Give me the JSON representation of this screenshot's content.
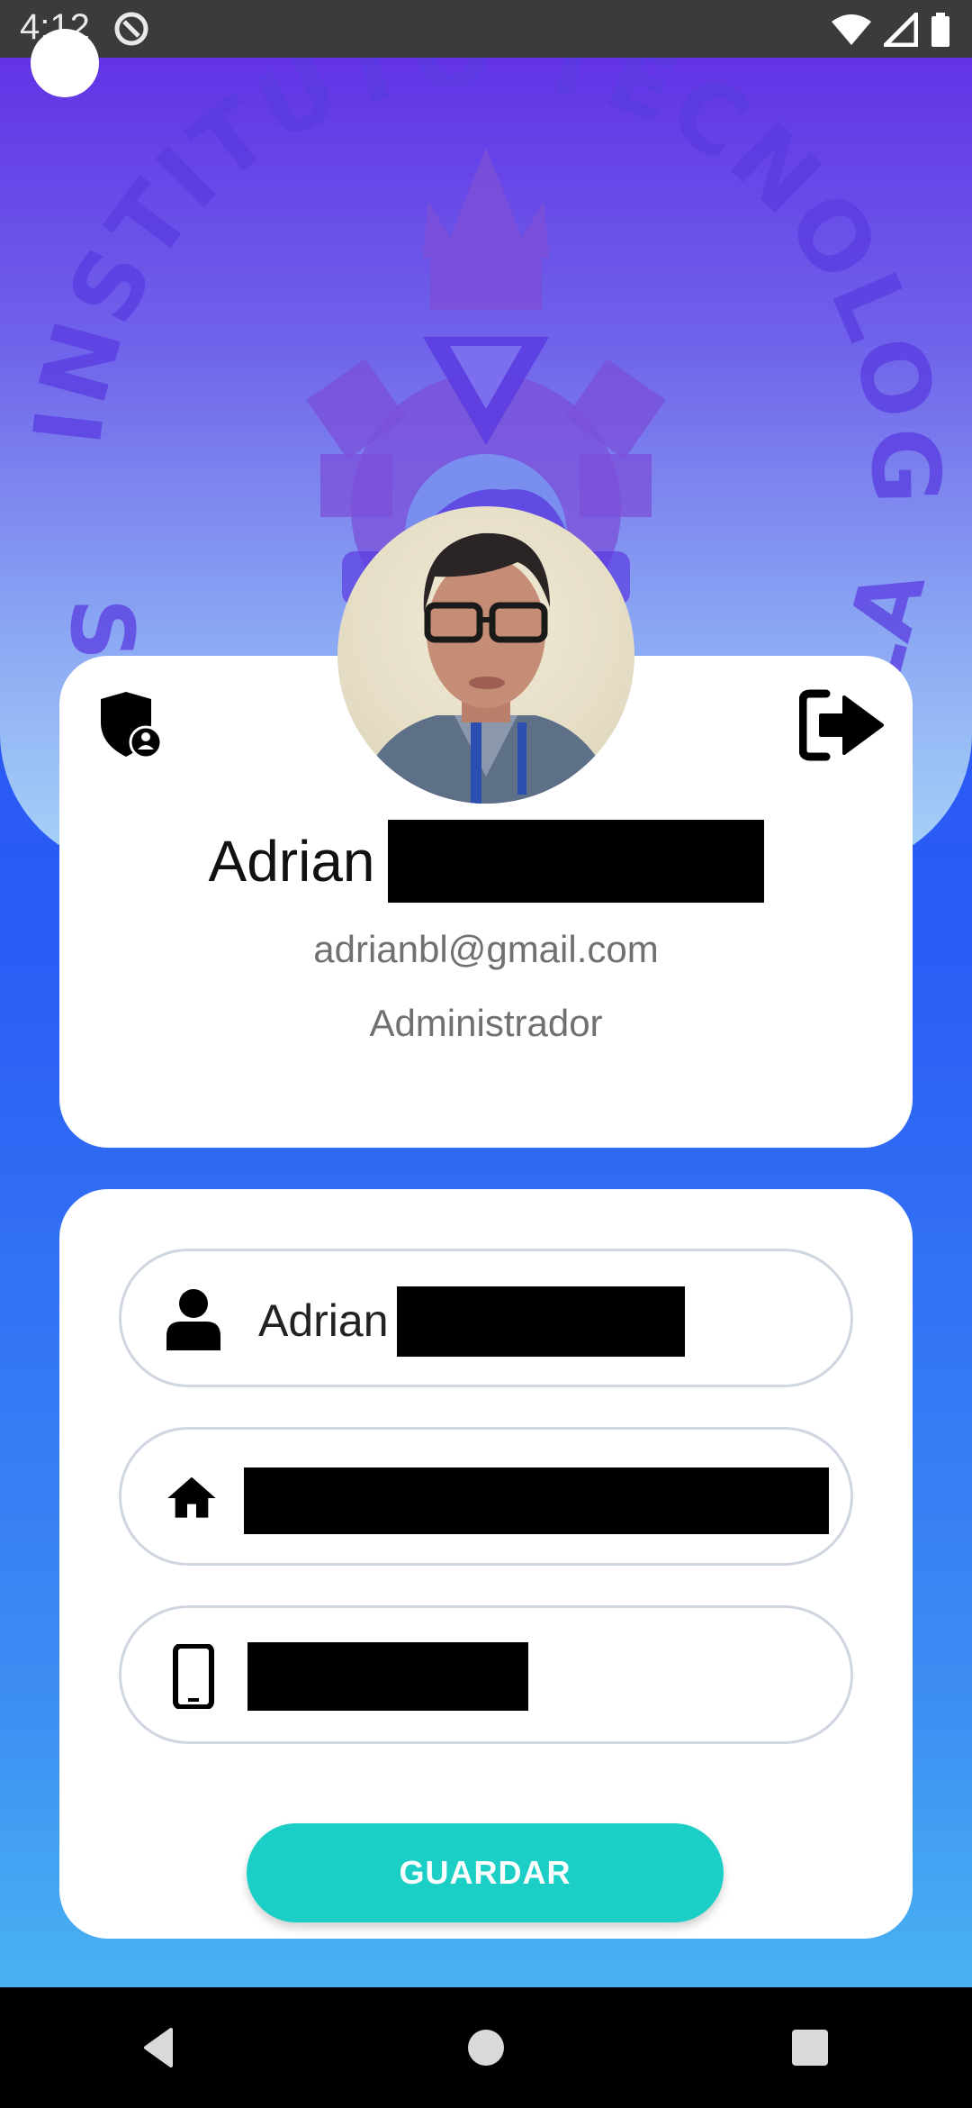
{
  "status_bar": {
    "time": "4:12"
  },
  "emblem": {
    "top_arc_text": "INSTITUTO TECNOLOGICO",
    "left_fragment": "SU",
    "right_fragment": "LA"
  },
  "profile": {
    "first_name": "Adrian",
    "email": "adrianbl@gmail.com",
    "role": "Administrador"
  },
  "form": {
    "name_value": "Adrian",
    "save_label": "GUARDAR"
  },
  "icons": {
    "shield": "admin-shield-icon",
    "logout": "logout-icon",
    "person": "person-icon",
    "home": "home-icon",
    "phone": "phone-icon"
  },
  "colors": {
    "accent": "#1bcfc6",
    "header_top": "#6233e6",
    "background_bottom": "#4fc1f2"
  }
}
